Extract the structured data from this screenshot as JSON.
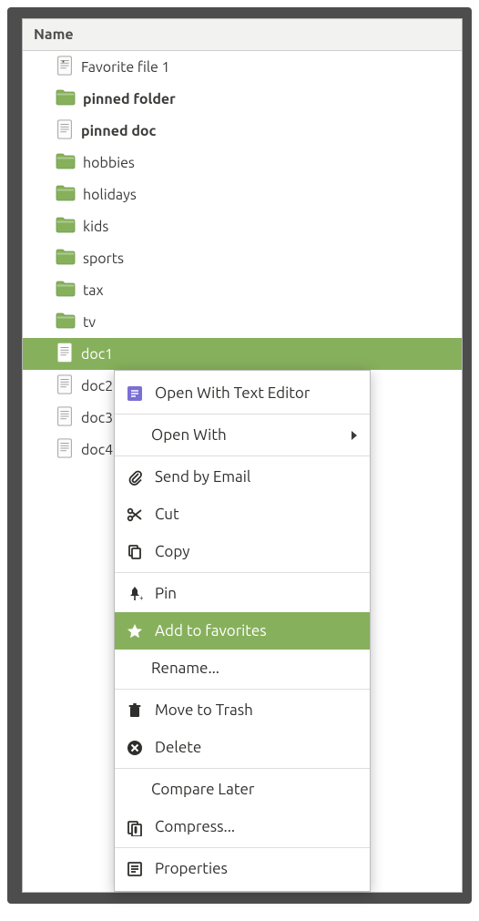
{
  "header": {
    "title": "Name"
  },
  "colors": {
    "accent": "#87b05c"
  },
  "tree": {
    "items": [
      {
        "label": "Favorite file 1",
        "kind": "doc",
        "style": "fav"
      },
      {
        "label": "pinned folder",
        "kind": "folder",
        "style": "bold"
      },
      {
        "label": "pinned doc",
        "kind": "doc",
        "style": "bold"
      },
      {
        "label": "hobbies",
        "kind": "folder"
      },
      {
        "label": "holidays",
        "kind": "folder"
      },
      {
        "label": "kids",
        "kind": "folder"
      },
      {
        "label": "sports",
        "kind": "folder"
      },
      {
        "label": "tax",
        "kind": "folder"
      },
      {
        "label": "tv",
        "kind": "folder"
      },
      {
        "label": "doc1",
        "kind": "doc",
        "selected": true
      },
      {
        "label": "doc2",
        "kind": "doc"
      },
      {
        "label": "doc3",
        "kind": "doc"
      },
      {
        "label": "doc4",
        "kind": "doc"
      }
    ]
  },
  "menu": {
    "items": [
      {
        "label": "Open With Text Editor",
        "icon": "text-editor"
      },
      {
        "sep": true
      },
      {
        "label": "Open With",
        "icon": "none",
        "submenu": true,
        "indent": true
      },
      {
        "sep": true
      },
      {
        "label": "Send by Email",
        "icon": "paperclip"
      },
      {
        "label": "Cut",
        "icon": "scissors"
      },
      {
        "label": "Copy",
        "icon": "copy"
      },
      {
        "sep": true
      },
      {
        "label": "Pin",
        "icon": "pin"
      },
      {
        "label": "Add to favorites",
        "icon": "star",
        "highlight": true
      },
      {
        "label": "Rename...",
        "icon": "none",
        "indent": true
      },
      {
        "sep": true
      },
      {
        "label": "Move to Trash",
        "icon": "trash"
      },
      {
        "label": "Delete",
        "icon": "delete"
      },
      {
        "sep": true
      },
      {
        "label": "Compare Later",
        "icon": "none",
        "indent": true
      },
      {
        "label": "Compress...",
        "icon": "compress"
      },
      {
        "sep": true
      },
      {
        "label": "Properties",
        "icon": "properties"
      }
    ]
  }
}
